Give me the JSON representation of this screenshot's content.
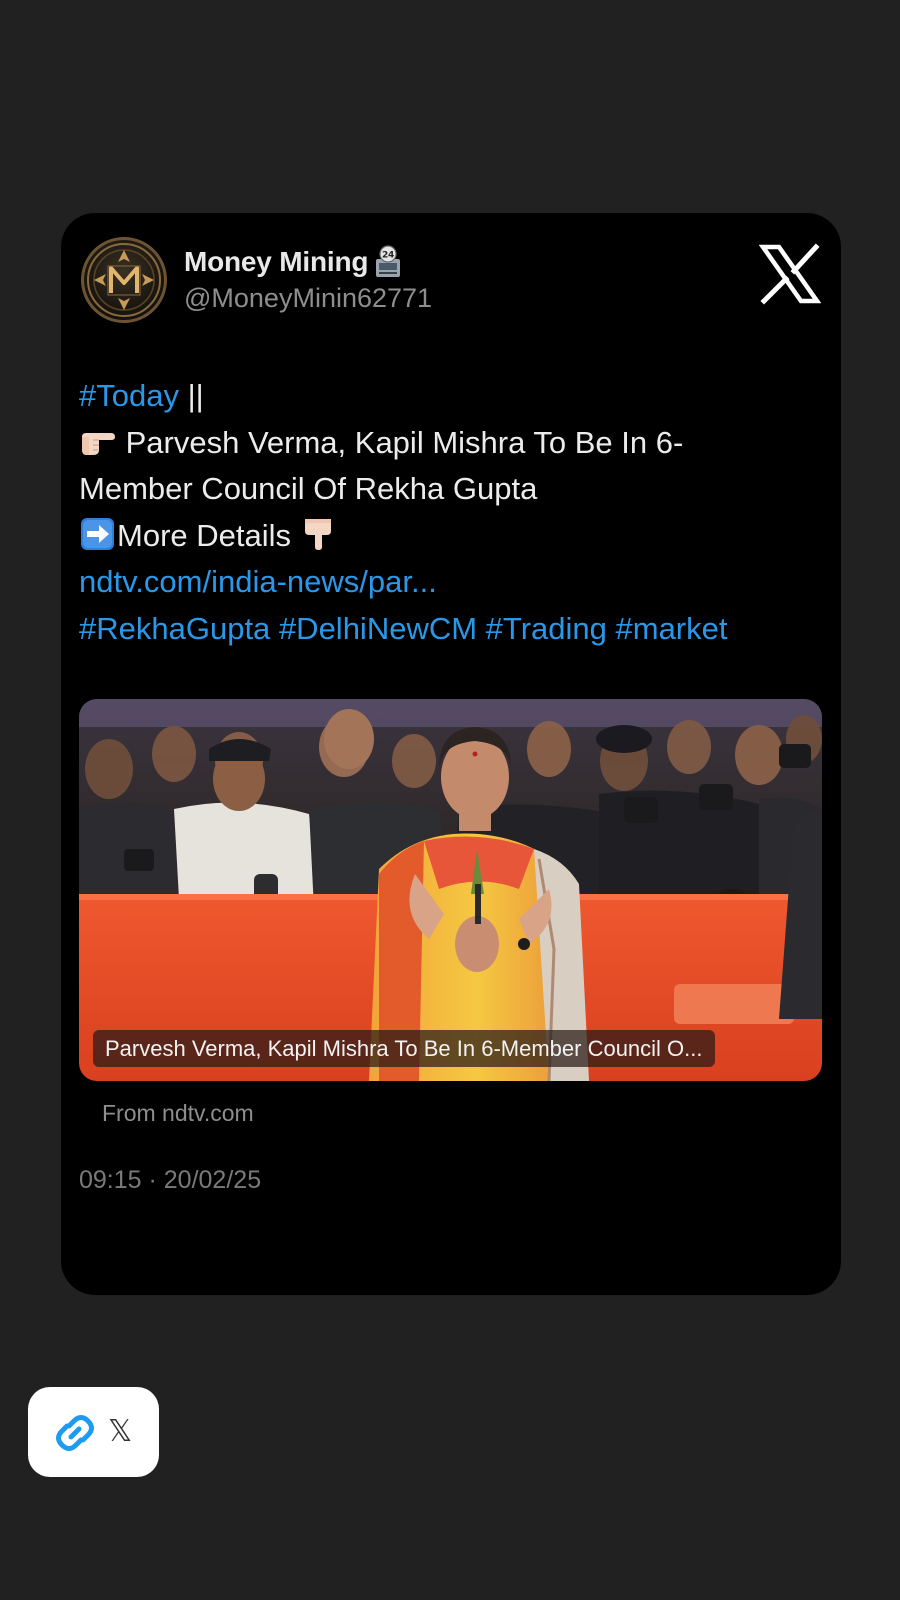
{
  "tweet": {
    "display_name": "Money Mining",
    "handle": "@MoneyMinin62771",
    "hashtag_today": "#Today",
    "separator": " ||",
    "headline_line1": " Parvesh Verma, Kapil Mishra To Be In 6-",
    "headline_line2": "Member Council Of Rekha Gupta",
    "more_details": "More Details ",
    "link": "ndtv.com/india-news/par...",
    "hashtags": [
      "#RekhaGupta",
      "#DelhiNewCM",
      "#Trading",
      "#market"
    ],
    "media_caption": "Parvesh Verma, Kapil Mishra To Be In 6-Member Council O...",
    "source": "From ndtv.com",
    "timestamp": "09:15 · 20/02/25"
  },
  "icons": {
    "avatar": "money-mining-logo",
    "name_badge": "24-hour-atm-emoji",
    "brand": "x-logo-icon",
    "pointer_right": "backhand-index-pointing-right-emoji",
    "arrow_right": "right-arrow-emoji",
    "pointer_down": "backhand-index-pointing-down-emoji",
    "share_link": "link-icon"
  },
  "share_chip": {
    "label": "𝕏"
  },
  "colors": {
    "background": "#212121",
    "card": "#000000",
    "link": "#2a98e8",
    "text": "#ececec",
    "muted": "#8e8e8e",
    "share_link_icon": "#1d9bf0"
  }
}
